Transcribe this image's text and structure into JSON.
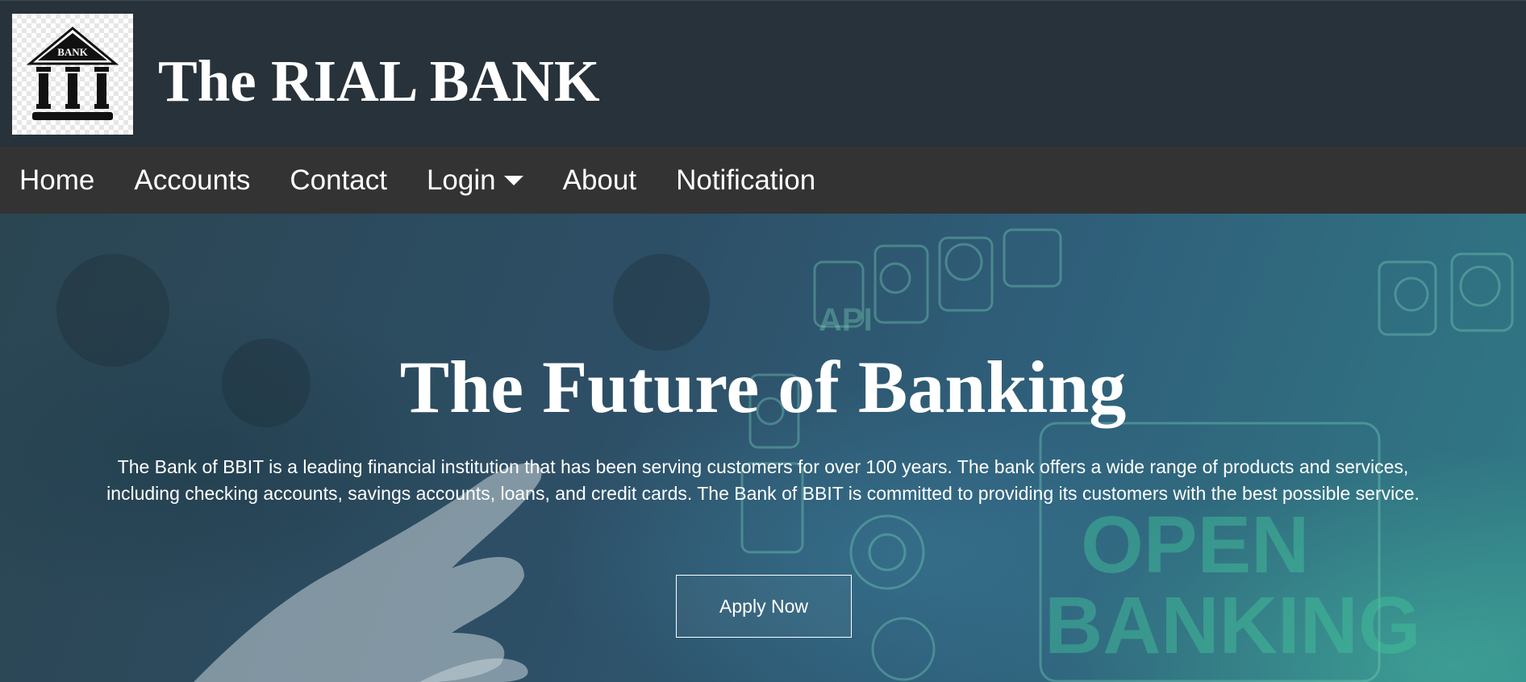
{
  "header": {
    "logo": {
      "icon": "bank-building-icon",
      "text": "BANK"
    },
    "site_title": "The RIAL BANK"
  },
  "nav": {
    "items": [
      {
        "label": "Home"
      },
      {
        "label": "Accounts"
      },
      {
        "label": "Contact"
      },
      {
        "label": "Login",
        "has_dropdown": true,
        "icon": "caret-down-icon"
      },
      {
        "label": "About"
      },
      {
        "label": "Notification"
      }
    ]
  },
  "hero": {
    "title": "The Future of Banking",
    "description": "The Bank of BBIT is a leading financial institution that has been serving customers for over 100 years. The bank offers a wide range of products and services, including checking accounts, savings accounts, loans, and credit cards. The Bank of BBIT is committed to providing its customers with the best possible service.",
    "cta_label": "Apply Now",
    "background_words": [
      "API",
      "OPEN",
      "BANKING"
    ]
  },
  "colors": {
    "header_bg": "#27323a",
    "nav_bg": "#333333",
    "text": "#ffffff",
    "hero_accent": "#3fbf9a"
  }
}
